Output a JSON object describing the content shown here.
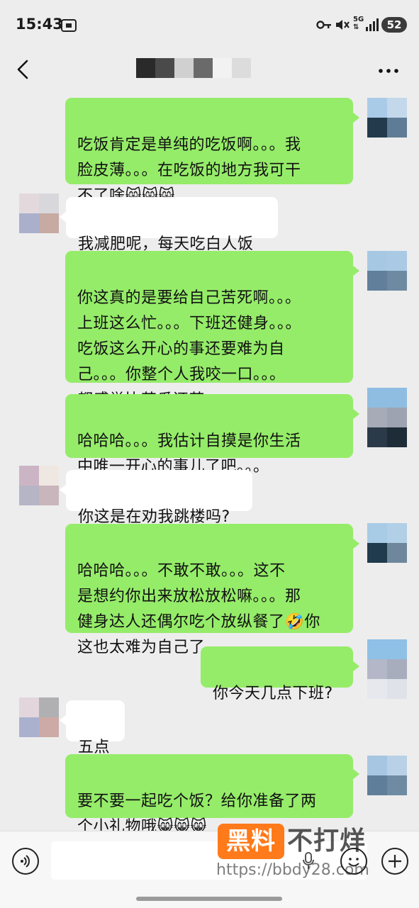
{
  "status_bar": {
    "time": "15:43",
    "network": "5G",
    "battery": "52"
  },
  "header": {
    "back_icon": "chevron-left-icon",
    "more_icon": "more-dots-icon"
  },
  "colors": {
    "background": "#ededed",
    "my_bubble": "#95ec69",
    "other_bubble": "#ffffff",
    "watermark": "#ff7a1a"
  },
  "messages": [
    {
      "sender": "me",
      "text": "吃饭肯定是单纯的吃饭啊。。。我\n脸皮薄。。。在吃饭的地方我可干\n不了啥",
      "emoji": "😸😸😸"
    },
    {
      "sender": "other",
      "text": "我减肥呢，每天吃白人饭"
    },
    {
      "sender": "me",
      "text": "你这真的是要给自己苦死啊。。。\n上班这么忙。。。下班还健身。。。\n吃饭这么开心的事还要难为自\n己。。。你整个人我咬一口。。。\n都感觉比苦瓜还苦。。。"
    },
    {
      "sender": "me",
      "text": "哈哈哈。。。我估计自摸是你生活\n中唯一开心的事儿了吧。。。"
    },
    {
      "sender": "other",
      "text": "你这是在劝我跳楼吗?"
    },
    {
      "sender": "me",
      "text": "哈哈哈。。。不敢不敢。。。这不\n是想约你出来放松放松嘛。。。那\n健身达人还偶尔吃个放纵餐了🤣你\n这也太难为自己了"
    },
    {
      "sender": "me",
      "text": "你今天几点下班?"
    },
    {
      "sender": "other",
      "text": "五点"
    },
    {
      "sender": "me",
      "text": "要不要一起吃个饭？给你准备了两\n个小礼物哦",
      "emoji": "😸😸😸"
    }
  ],
  "input_bar": {
    "voice_icon": "voice-icon",
    "emoji_icon": "emoji-icon",
    "plus_icon": "plus-icon",
    "placeholder": ""
  },
  "watermark": {
    "logo": "黑料",
    "tail": "不打烊",
    "url": "https://bbdy28.com"
  }
}
